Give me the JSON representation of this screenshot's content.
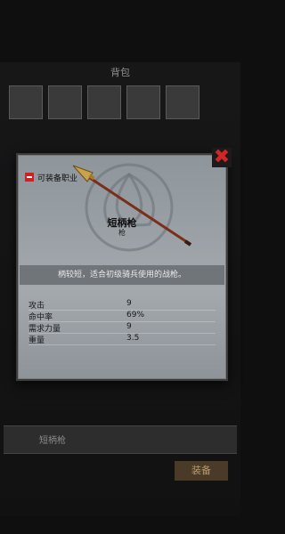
{
  "background": {
    "header_title": "背包",
    "item_label": "短柄枪",
    "equip_button_label": "装备"
  },
  "modal": {
    "tag_label": "可装备职业",
    "item_name": "短柄枪",
    "item_type": "枪",
    "description": "柄较短，适合初级骑兵使用的战枪。",
    "stats": [
      {
        "label": "攻击",
        "value": "9"
      },
      {
        "label": "命中率",
        "value": "69%"
      },
      {
        "label": "需求力量",
        "value": "9"
      },
      {
        "label": "重量",
        "value": "3.5"
      }
    ],
    "close_glyph": "✖"
  },
  "colors": {
    "close": "#d22525",
    "spear_shaft": "#7a2f1a",
    "spear_tip": "#c9a24a"
  }
}
